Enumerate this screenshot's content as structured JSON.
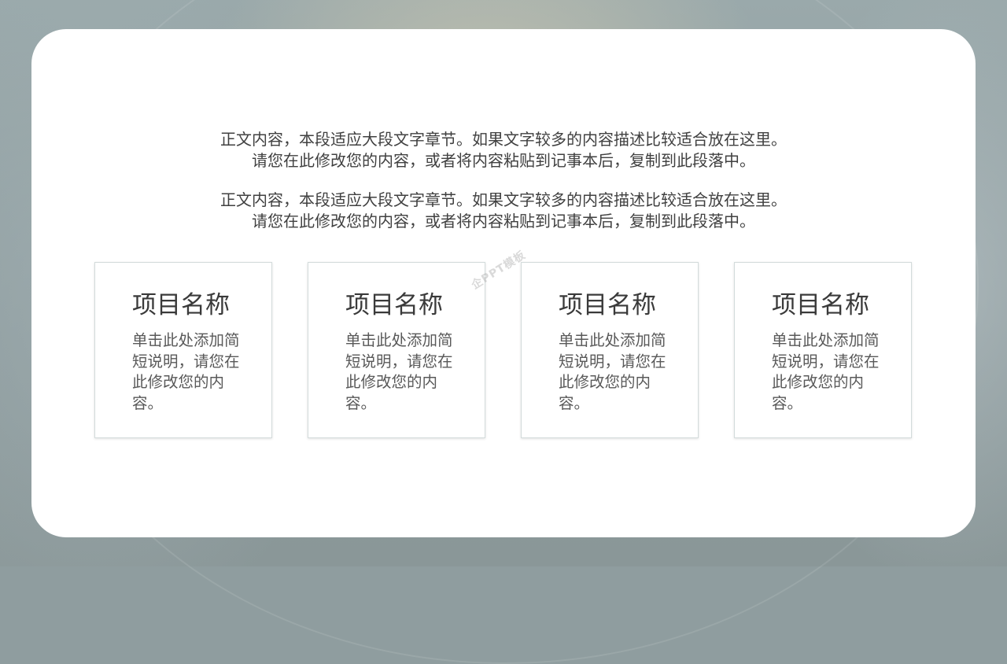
{
  "slide": {
    "paragraphs": [
      {
        "line1": "正文内容，本段适应大段文字章节。如果文字较多的内容描述比较适合放在这里。",
        "line2": "请您在此修改您的内容，或者将内容粘贴到记事本后，复制到此段落中。"
      },
      {
        "line1": "正文内容，本段适应大段文字章节。如果文字较多的内容描述比较适合放在这里。",
        "line2": "请您在此修改您的内容，或者将内容粘贴到记事本后，复制到此段落中。"
      }
    ],
    "items": [
      {
        "title": "项目名称",
        "description": "单击此处添加简短说明，请您在此修改您的内容。"
      },
      {
        "title": "项目名称",
        "description": "单击此处添加简短说明，请您在此修改您的内容。"
      },
      {
        "title": "项目名称",
        "description": "单击此处添加简短说明，请您在此修改您的内容。"
      },
      {
        "title": "项目名称",
        "description": "单击此处添加简短说明，请您在此修改您的内容。"
      }
    ],
    "watermark": "企PPT模板"
  },
  "colors": {
    "background": "#8f9d9f",
    "card": "#ffffff",
    "body_text": "#404040",
    "item_border": "#d3dbdb"
  }
}
